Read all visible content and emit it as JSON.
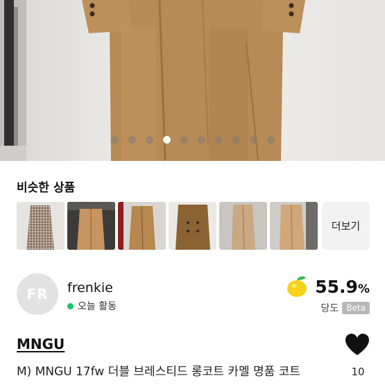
{
  "gallery": {
    "slide_count": 10,
    "active_index": 3
  },
  "similar": {
    "title": "비슷한 상품",
    "more_label": "더보기",
    "items": [
      {
        "name": "tweed-coat"
      },
      {
        "name": "camel-coat-hanger"
      },
      {
        "name": "camel-coat-rack"
      },
      {
        "name": "brown-double-coat"
      },
      {
        "name": "beige-long-coat"
      },
      {
        "name": "camel-long-coat"
      }
    ]
  },
  "seller": {
    "initials": "FR",
    "name": "frenkie",
    "status": "오늘 활동",
    "sweetness": "55.9",
    "sweetness_unit": "%",
    "sweetness_label": "당도",
    "beta_label": "Beta"
  },
  "product": {
    "brand": "MNGU",
    "title": "M) MNGU 17fw 더블 브레스티드 롱코트 카멜 명품 코트",
    "likes": "10"
  },
  "colors": {
    "online": "#19c46a",
    "coat": "#b88a55"
  }
}
